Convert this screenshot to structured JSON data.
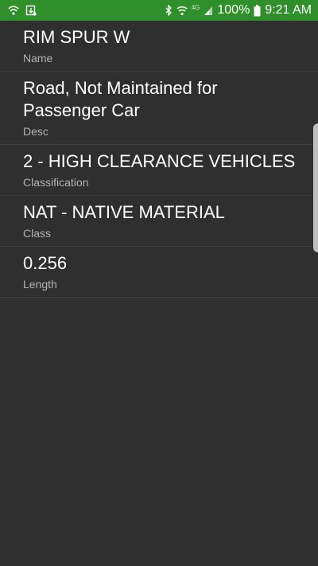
{
  "status_bar": {
    "background": "#2f8f2a",
    "left_icons": [
      "wifi-hotspot-icon",
      "download-notification-icon"
    ],
    "right_icons": [
      "bluetooth-icon",
      "wifi-icon",
      "signal-icon",
      "battery-icon"
    ],
    "network_label": "4G",
    "battery": "100%",
    "time": "9:21 AM"
  },
  "fields": [
    {
      "value": "RIM SPUR W",
      "label": "Name"
    },
    {
      "value": "Road, Not Maintained for\nPassenger Car",
      "label": "Desc"
    },
    {
      "value": "2 - HIGH CLEARANCE VEHICLES",
      "label": "Classification"
    },
    {
      "value": "NAT - NATIVE MATERIAL",
      "label": "Class"
    },
    {
      "value": "0.256",
      "label": "Length"
    }
  ]
}
